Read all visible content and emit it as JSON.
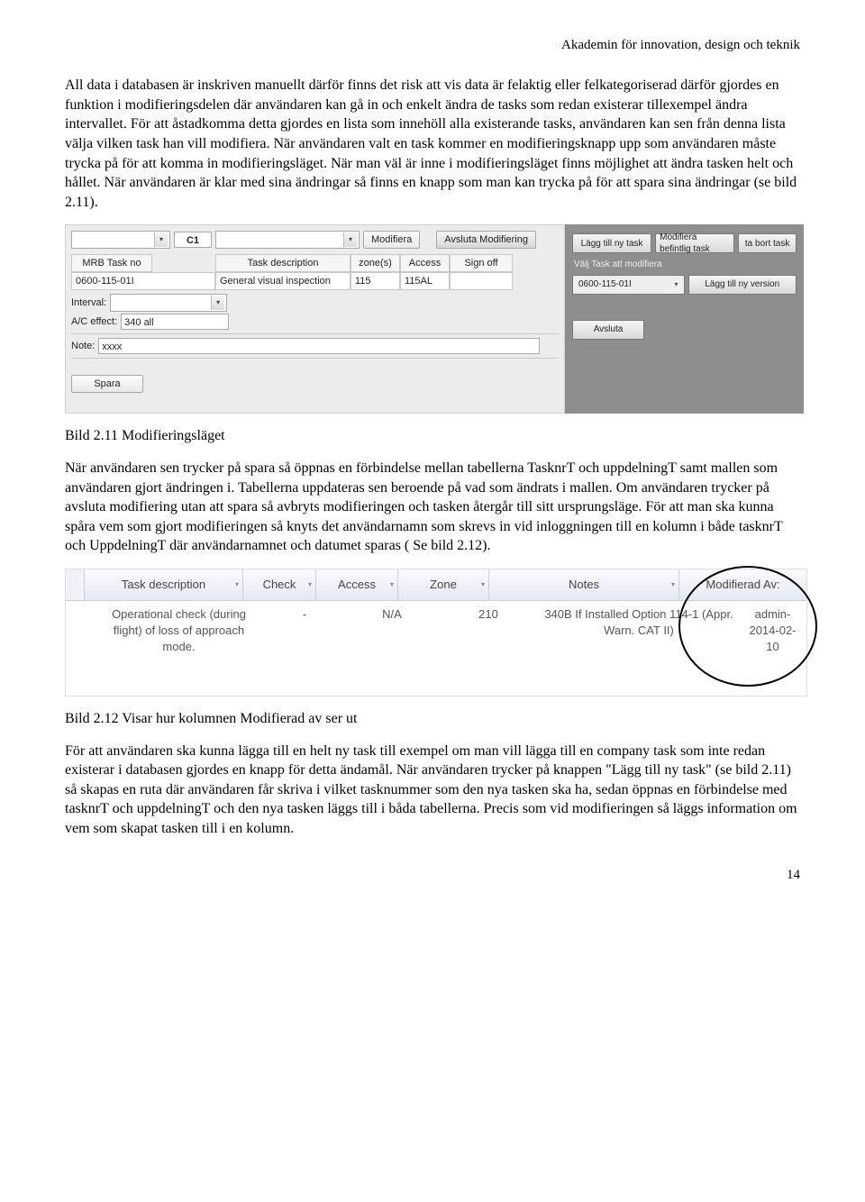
{
  "header": "Akademin för innovation, design och teknik",
  "p1": "All data i databasen är inskriven manuellt därför finns det risk att vis data är felaktig eller felkategoriserad därför gjordes en funktion i modifieringsdelen där användaren kan gå in och enkelt ändra de tasks som redan existerar tillexempel ändra intervallet. För att åstadkomma detta gjordes en lista som innehöll alla existerande tasks, användaren kan sen från denna lista välja vilken task han vill modifiera. När användaren valt en task kommer en modifieringsknapp upp som användaren måste trycka på för att komma in modifieringsläget. När man väl är inne i modifieringsläget finns möjlighet att ändra tasken helt och hållet. När användaren är klar med sina ändringar så finns en knapp som  man kan  trycka på för att spara sina ändringar (se bild 2.11).",
  "caption1": "Bild 2.11 Modifieringsläget",
  "p2": "När användaren sen trycker på spara så öppnas en förbindelse mellan tabellerna TasknrT och uppdelningT samt  mallen som användaren gjort ändringen i. Tabellerna uppdateras sen beroende på vad som ändrats i mallen. Om användaren trycker på avsluta modifiering utan att spara så avbryts modifieringen och tasken återgår till sitt ursprungsläge. För att man ska kunna spåra vem som gjort modifieringen så knyts det användarnamn som skrevs in vid inloggningen till en kolumn i både tasknrT och UppdelningT där användarnamnet och datumet sparas ( Se bild 2.12).",
  "caption2": "Bild 2.12 Visar hur kolumnen Modifierad av ser ut",
  "p3": "För att användaren ska kunna lägga till en helt ny task till exempel om man vill lägga till en company task som inte redan existerar i databasen gjordes en knapp för detta ändamål. När användaren trycker på knappen \"Lägg till ny task\" (se bild 2.11) så skapas en ruta där användaren får  skriva i vilket tasknummer som den nya tasken ska ha, sedan öppnas en förbindelse med tasknrT och uppdelningT och den nya tasken läggs till i båda tabellerna. Precis som vid modifieringen så läggs information om vem som skapat tasken till i en kolumn.",
  "page": "14",
  "shot1": {
    "toprow": {
      "c1": "C1",
      "modify": "Modifiera",
      "end": "Avsluta Modifiering"
    },
    "cols": {
      "task": "MRB Task no",
      "desc": "Task description",
      "zone": "zone(s)",
      "access": "Access",
      "sign": "Sign off"
    },
    "vals": {
      "task": "0600-115-01I",
      "desc": "General visual inspection",
      "zone": "115",
      "access": "115AL"
    },
    "labels": {
      "interval": "Interval:",
      "ac": "A/C effect:",
      "acval": "340 all",
      "note": "Note:",
      "noteval": "xxxx",
      "save": "Spara"
    },
    "right": {
      "add": "Lägg till ny task",
      "mod": "Modifiera befintlig task",
      "del": "ta bort task",
      "choose": "Välj Task att modifiera",
      "combo": "0600-115-01I",
      "ver": "Lägg till ny version",
      "close": "Avsluta"
    }
  },
  "shot2": {
    "h": {
      "desc": "Task description",
      "check": "Check",
      "access": "Access",
      "zone": "Zone",
      "notes": "Notes",
      "mod": "Modifierad Av:"
    },
    "r": {
      "desc": "Operational check (during flight) of loss of approach mode.",
      "check": "-",
      "access": "N/A",
      "zone": "210",
      "notes": "340B If Installed Option 114-1 (Appr. Warn. CAT II)",
      "mod": "admin-2014-02-10"
    }
  }
}
